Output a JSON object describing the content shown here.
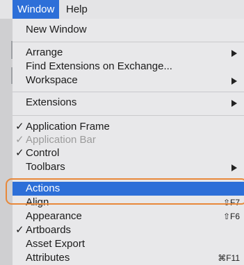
{
  "menubar": {
    "window_label": "Window",
    "help_label": "Help"
  },
  "menu": {
    "new_window": "New Window",
    "arrange": "Arrange",
    "find_extensions": "Find Extensions on Exchange...",
    "workspace": "Workspace",
    "extensions": "Extensions",
    "application_frame": "Application Frame",
    "application_bar": "Application Bar",
    "control": "Control",
    "toolbars": "Toolbars",
    "actions": "Actions",
    "align": "Align",
    "align_shortcut": "⇧F7",
    "appearance": "Appearance",
    "appearance_shortcut": "⇧F6",
    "artboards": "Artboards",
    "asset_export": "Asset Export",
    "attributes": "Attributes",
    "attributes_shortcut": "⌘F11",
    "checkmark": "✓"
  },
  "colors": {
    "highlight": "#2d6fd8",
    "annotation": "#e8883a"
  }
}
